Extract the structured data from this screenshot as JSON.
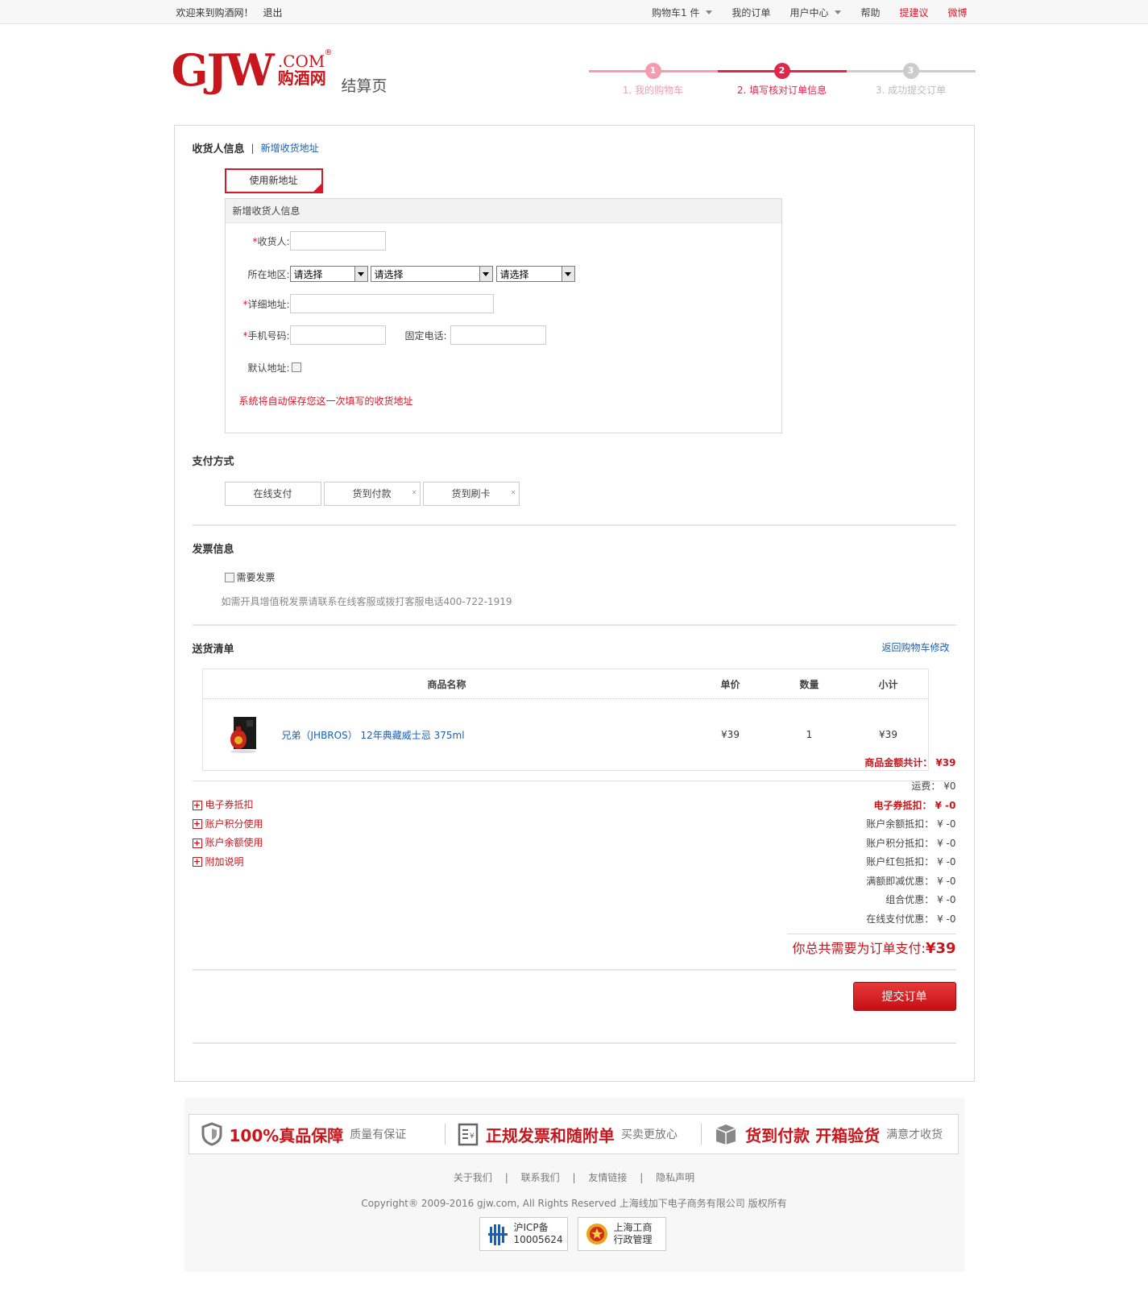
{
  "topbar": {
    "welcome": "欢迎来到购酒网！",
    "logout": "退出",
    "cart": "购物车1 件",
    "my_orders": "我的订单",
    "user_center": "用户中心",
    "help": "帮助",
    "suggest": "提建议",
    "weibo": "微博"
  },
  "header": {
    "logo_main": "GJW",
    "logo_com": ".COM",
    "logo_cn": "购酒网",
    "logo_reg": "®",
    "page_name": "结算页",
    "steps": [
      {
        "num": "1",
        "label": "1. 我的购物车"
      },
      {
        "num": "2",
        "label": "2. 填写核对订单信息"
      },
      {
        "num": "3",
        "label": "3. 成功提交订单"
      }
    ],
    "colors": {
      "step1": "#f29cad",
      "step2": "#e0264b",
      "step3": "#cccccc"
    }
  },
  "consignee": {
    "title": "收货人信息",
    "sep": "|",
    "add_link": "新增收货地址",
    "use_new_btn": "使用新地址",
    "box_title": "新增收货人信息",
    "name_label": "收货人:",
    "region_label": "所在地区:",
    "region_selects": [
      "请选择",
      "请选择",
      "请选择"
    ],
    "detail_label": "详细地址:",
    "mobile_label": "手机号码:",
    "phone_label": "固定电话:",
    "default_label": "默认地址:",
    "required_mark": "*",
    "note": "系统将自动保存您这一次填写的收货地址"
  },
  "payment": {
    "title": "支付方式",
    "options": [
      "在线支付",
      "货到付款",
      "货到刷卡"
    ]
  },
  "invoice": {
    "title": "发票信息",
    "need_label": "需要发票",
    "note": "如需开具增值税发票请联系在线客服或拨打客服电话400-722-1919"
  },
  "delivery": {
    "title": "送货清单",
    "back_link": "返回购物车修改",
    "columns": [
      "商品名称",
      "单价",
      "数量",
      "小计"
    ],
    "items": [
      {
        "name": "兄弟（JHBROS） 12年典藏威士忌 375ml",
        "price": "¥39",
        "qty": "1",
        "subtotal": "¥39"
      }
    ]
  },
  "summary": {
    "goods_total": "商品金额共计： ¥39",
    "shipping": "运费： ¥0",
    "coupon": "电子券抵扣： ¥ -0",
    "balance": "账户余额抵扣： ¥ -0",
    "points": "账户积分抵扣： ¥ -0",
    "redpacket": "账户红包抵扣： ¥ -0",
    "full_reduce": "满额即减优惠： ¥ -0",
    "combo": "组合优惠： ¥ -0",
    "online_pay": "在线支付优惠： ¥ -0",
    "grand_label": "你总共需要为订单支付:",
    "grand_value": "¥39"
  },
  "options": [
    "电子券抵扣",
    "账户积分使用",
    "账户余额使用",
    "附加说明"
  ],
  "submit": "提交订单",
  "footer": {
    "guarantees": [
      {
        "big": "100%真品保障",
        "small": "质量有保证"
      },
      {
        "big": "正规发票和随附单",
        "small": "买卖更放心"
      },
      {
        "big": "货到付款 开箱验货",
        "small": "满意才收货"
      }
    ],
    "links": [
      "关于我们",
      "联系我们",
      "友情链接",
      "隐私声明"
    ],
    "copyright": "Copyright® 2009-2016 gjw.com, All Rights Reserved 上海线加下电子商务有限公司 版权所有",
    "badge1_line1": "沪ICP备",
    "badge1_line2": "10005624",
    "badge2_line1": "上海工商",
    "badge2_line2": "行政管理"
  },
  "colors": {
    "brand_red": "#c8161d",
    "link_blue": "#1a5fb4"
  }
}
